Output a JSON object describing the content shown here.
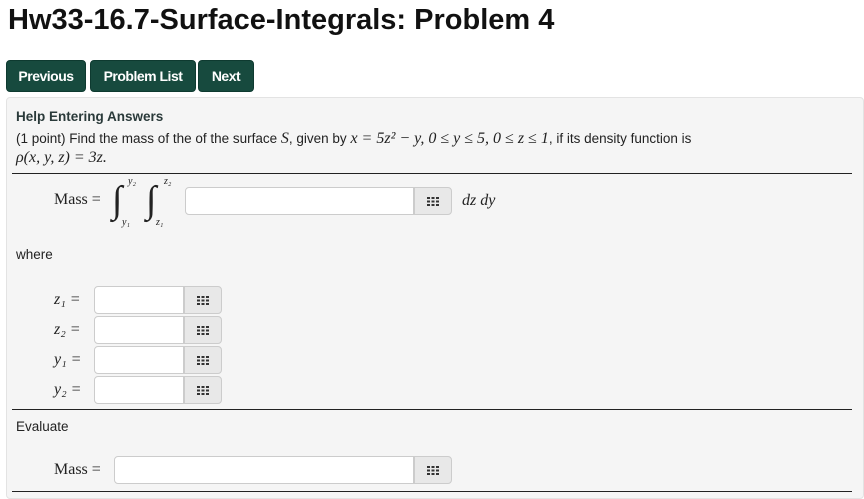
{
  "title": "Hw33-16.7-Surface-Integrals: Problem 4",
  "nav": {
    "previous": "Previous",
    "problem_list": "Problem List",
    "next": "Next"
  },
  "help_link": "Help Entering Answers",
  "problem": {
    "intro": "(1 point) Find the mass of the of the surface ",
    "S": "S",
    ", given by": ", given by ",
    "surface_eq": "x = 5z² − y,  0 ≤ y ≤ 5,  0 ≤ z ≤ 1",
    "tail": ", if its density function is",
    "density": "ρ(x, y, z) = 3z."
  },
  "integral": {
    "label": "Mass =",
    "upper_outer": "y₂",
    "lower_outer": "y₁",
    "upper_inner": "z₂",
    "lower_inner": "z₁",
    "differentials": "dz dy",
    "value": ""
  },
  "where_label": "where",
  "limits": [
    {
      "label": "z₁ =",
      "value": ""
    },
    {
      "label": "z₂ =",
      "value": ""
    },
    {
      "label": "y₁ =",
      "value": ""
    },
    {
      "label": "y₂ =",
      "value": ""
    }
  ],
  "evaluate_label": "Evaluate",
  "mass": {
    "label": "Mass =",
    "value": ""
  },
  "colors": {
    "button": "#174a3e",
    "panel": "#f5f5f5"
  }
}
